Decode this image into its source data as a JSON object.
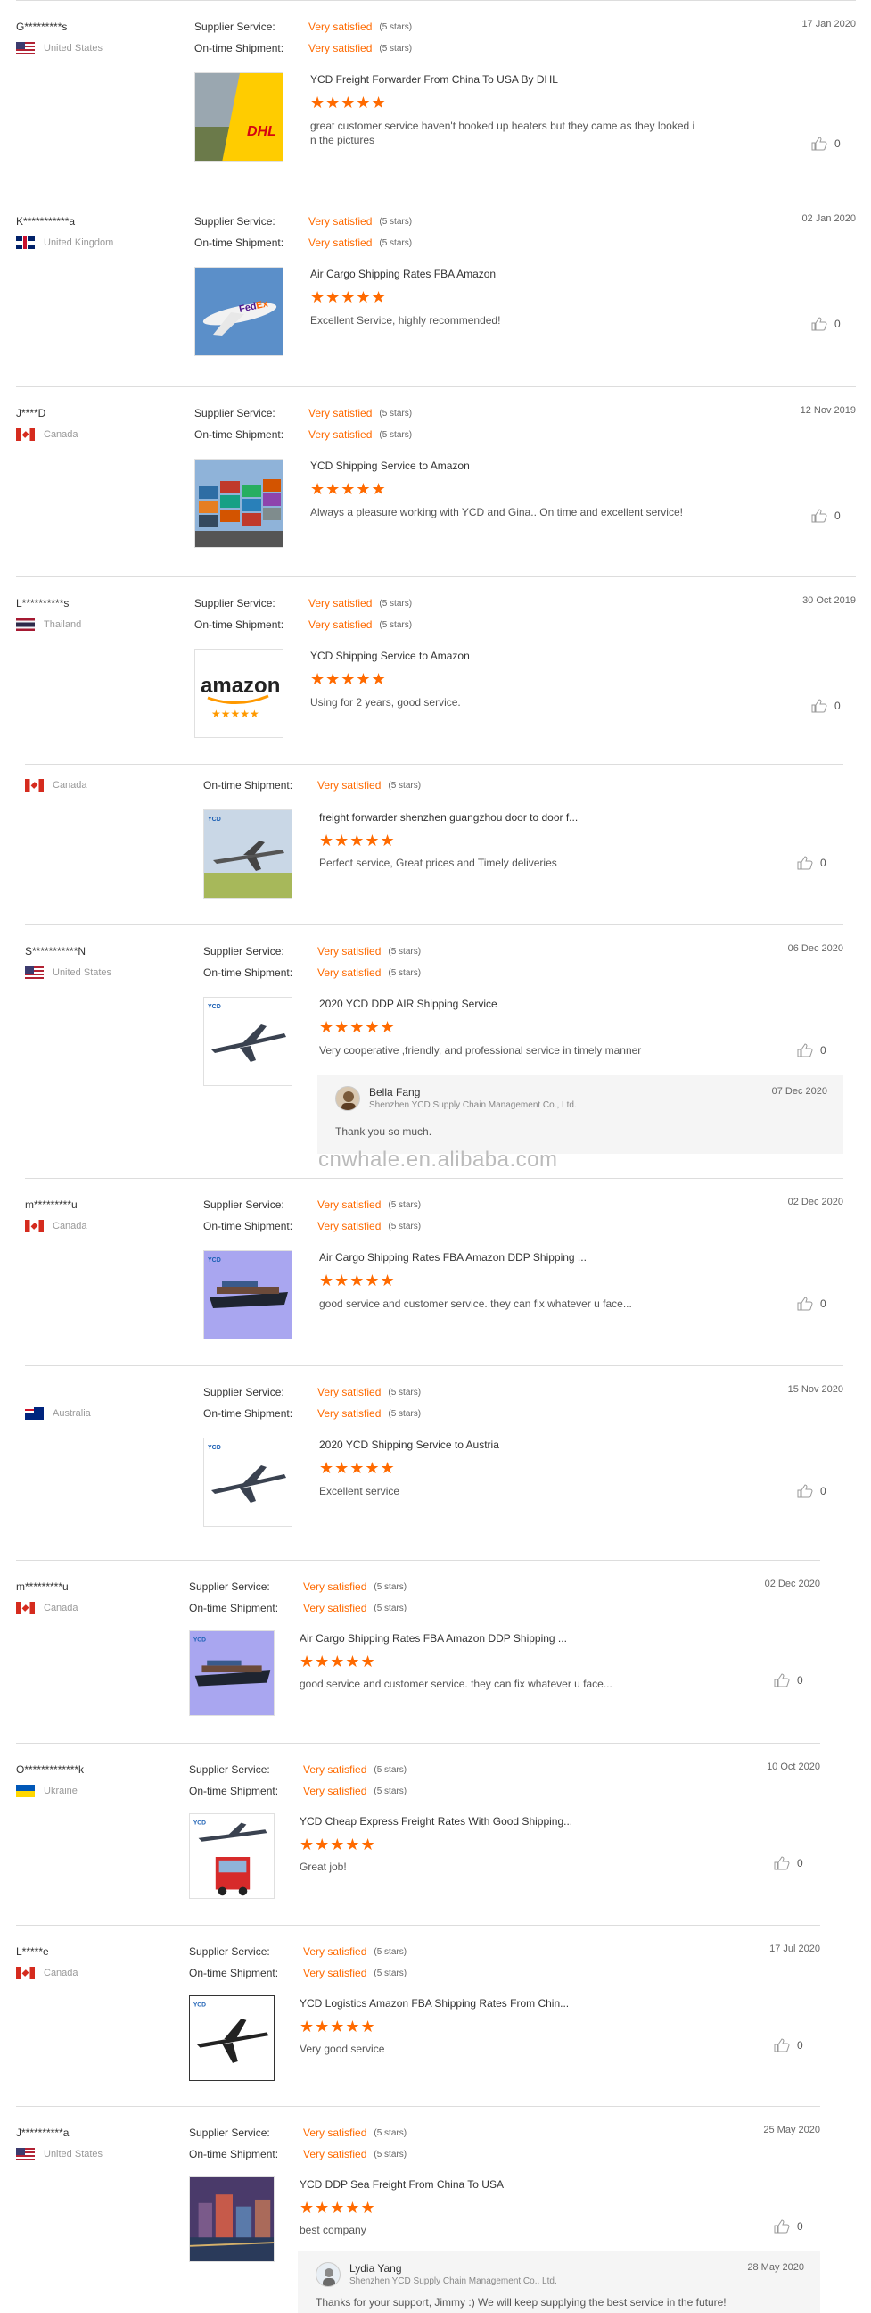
{
  "labels": {
    "supplier_service": "Supplier Service:",
    "ontime_shipment": "On-time Shipment:",
    "rating_value": "Very satisfied",
    "rating_stars": "(5 stars)",
    "stars_glyph": "★★★★★",
    "like_count": "0",
    "like_icon": "thumbs-up-icon"
  },
  "watermark": "cnwhale.en.alibaba.com",
  "reviews": [
    {
      "buyer": "G*********s",
      "country": "United States",
      "date": "17 Jan 2020",
      "product": "YCD Freight Forwarder From China To USA By DHL",
      "comment_line1": "great customer service haven't hooked up heaters but they came as they looked i",
      "comment_line2": "n the pictures"
    },
    {
      "buyer": "K***********a",
      "country": "United Kingdom",
      "date": "02 Jan 2020",
      "product": "Air Cargo Shipping Rates FBA Amazon",
      "comment_line1": "Excellent Service, highly recommended!"
    },
    {
      "buyer": "J****D",
      "country": "Canada",
      "date": "12 Nov 2019",
      "product": "YCD Shipping Service to Amazon",
      "comment_line1": "Always a pleasure working with YCD and Gina.. On time and excellent service!"
    },
    {
      "buyer": "L**********s",
      "country": "Thailand",
      "date": "30 Oct 2019",
      "product": "YCD Shipping Service to Amazon",
      "comment_line1": "Using for 2 years, good service."
    },
    {
      "buyer": "",
      "country": "Canada",
      "date": "",
      "product": "freight forwarder shenzhen guangzhou door to door f...",
      "comment_line1": "Perfect service, Great prices and Timely deliveries"
    },
    {
      "buyer": "S***********N",
      "country": "United States",
      "date": "06 Dec 2020",
      "product": "2020 YCD DDP AIR Shipping Service",
      "comment_line1": "Very cooperative ,friendly, and professional service in timely manner",
      "reply": {
        "name": "Bella Fang",
        "company": "Shenzhen YCD Supply Chain Management Co., Ltd.",
        "date": "07 Dec 2020",
        "text": "Thank you so much."
      }
    },
    {
      "buyer": "m*********u",
      "country": "Canada",
      "date": "02 Dec 2020",
      "product": "Air Cargo Shipping Rates FBA Amazon DDP Shipping ...",
      "comment_line1": "good service and customer service. they can fix whatever u face..."
    },
    {
      "buyer": "",
      "country": "Australia",
      "date": "15 Nov 2020",
      "product": "2020 YCD Shipping Service to Austria",
      "comment_line1": "Excellent service"
    },
    {
      "buyer": "m*********u",
      "country": "Canada",
      "date": "02 Dec 2020",
      "product": "Air Cargo Shipping Rates FBA Amazon DDP Shipping ...",
      "comment_line1": "good service and customer service. they can fix whatever u face..."
    },
    {
      "buyer": "O*************k",
      "country": "Ukraine",
      "date": "10 Oct 2020",
      "product": "YCD Cheap Express Freight Rates With Good Shipping...",
      "comment_line1": "Great job!"
    },
    {
      "buyer": "L*****e",
      "country": "Canada",
      "date": "17 Jul 2020",
      "product": "YCD Logistics Amazon FBA Shipping Rates From Chin...",
      "comment_line1": "Very good service"
    },
    {
      "buyer": "J**********a",
      "country": "United States",
      "date": "25 May 2020",
      "product": "YCD DDP Sea Freight From China To USA",
      "comment_line1": "best company",
      "reply": {
        "name": "Lydia Yang",
        "company": "Shenzhen YCD Supply Chain Management Co., Ltd.",
        "date": "28 May 2020",
        "text": "Thanks for your support, Jimmy :)  We will keep supplying the best service in the future!"
      }
    }
  ],
  "colors": {
    "accent": "#ff6a00",
    "divider": "#dddddd"
  }
}
